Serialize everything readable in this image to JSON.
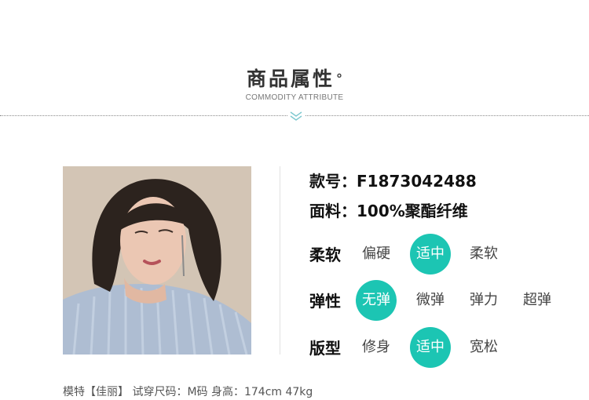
{
  "header": {
    "title": "商品属性",
    "degree_mark": "°",
    "subtitle": "COMMODITY ATTRIBUTE"
  },
  "colors": {
    "accent": "#1cc5b3",
    "chevron": "#7cc8cf"
  },
  "icons": {
    "chevron": "double-chevron-down-icon"
  },
  "specs": {
    "style_no": {
      "label": "款号：",
      "value": "F1873042488"
    },
    "fabric": {
      "label": "面料：",
      "value": "100%聚酯纤维"
    }
  },
  "attributes": [
    {
      "label": "柔软",
      "options": [
        "偏硬",
        "适中",
        "柔软"
      ],
      "selected": "适中"
    },
    {
      "label": "弹性",
      "options": [
        "无弹",
        "微弹",
        "弹力",
        "超弹"
      ],
      "selected": "无弹"
    },
    {
      "label": "版型",
      "options": [
        "修身",
        "适中",
        "宽松"
      ],
      "selected": "适中"
    }
  ],
  "caption": "模特【佳丽】 试穿尺码：M码 身高：174cm 47kg"
}
